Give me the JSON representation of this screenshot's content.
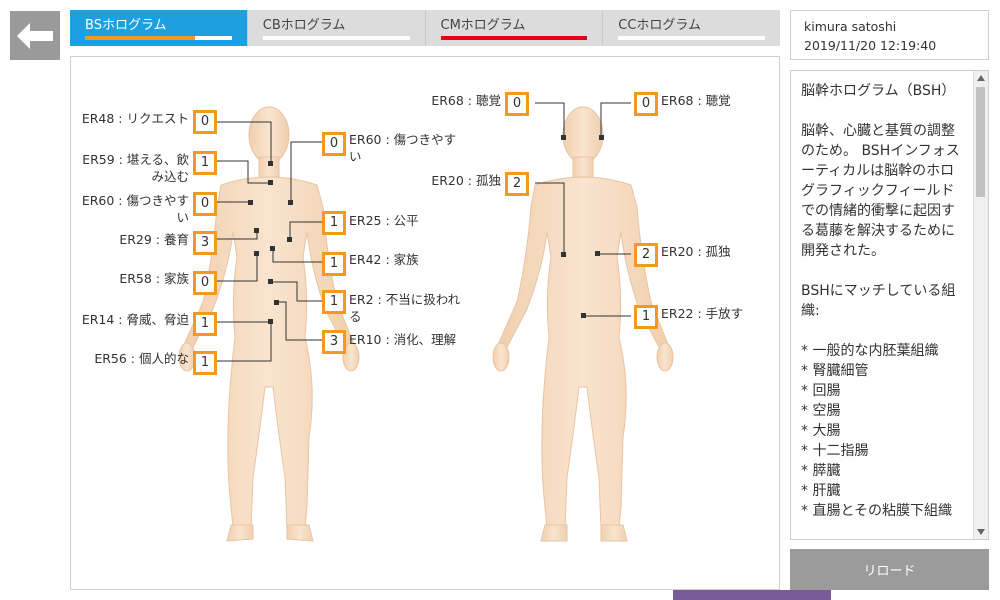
{
  "tabs": [
    {
      "label": "BSホログラム",
      "active": true,
      "bar_fill": 0.75,
      "bar_color": "#f39a1e"
    },
    {
      "label": "CBホログラム",
      "active": false,
      "bar_fill": 0,
      "bar_color": "#ffffff"
    },
    {
      "label": "CMホログラム",
      "active": false,
      "bar_fill": 1.0,
      "bar_color": "#e60012"
    },
    {
      "label": "CCホログラム",
      "active": false,
      "bar_fill": 0,
      "bar_color": "#ffffff"
    }
  ],
  "user": {
    "name": "kimura satoshi",
    "datetime": "2019/11/20 12:19:40"
  },
  "front_points": [
    {
      "label": "ER48 : リクエスト",
      "value": "0"
    },
    {
      "label": "ER59 : 堪える、飲み込む",
      "value": "1"
    },
    {
      "label": "ER60 : 傷つきやすい",
      "value": "0"
    },
    {
      "label": "ER29 : 養育",
      "value": "3"
    },
    {
      "label": "ER58 : 家族",
      "value": "0"
    },
    {
      "label": "ER14 : 脅威、脅迫",
      "value": "1"
    },
    {
      "label": "ER56 : 個人的な",
      "value": "1"
    },
    {
      "label": "ER60 : 傷つきやすい",
      "value": "0"
    },
    {
      "label": "ER25 : 公平",
      "value": "1"
    },
    {
      "label": "ER42 : 家族",
      "value": "1"
    },
    {
      "label": "ER2 : 不当に扱われる",
      "value": "1"
    },
    {
      "label": "ER10 : 消化、理解",
      "value": "3"
    }
  ],
  "back_points": [
    {
      "label": "ER68 : 聴覚",
      "value": "0"
    },
    {
      "label": "ER20 : 孤独",
      "value": "2"
    },
    {
      "label": "ER68 : 聴覚",
      "value": "0"
    },
    {
      "label": "ER20 : 孤独",
      "value": "2"
    },
    {
      "label": "ER22 : 手放す",
      "value": "1"
    }
  ],
  "description": {
    "title": "脳幹ホログラム（BSH）",
    "body": "脳幹、心臓と基質の調整のため。 BSHインフォスーティカルは脳幹のホログラフィックフィールドでの情緒的衝撃に起因する葛藤を解決するために開発された。",
    "list_title": "BSHにマッチしている組織:",
    "items": [
      "* 一般的な内胚葉組織",
      "* 腎臓細管",
      "* 回腸",
      "* 空腸",
      "* 大腸",
      "* 十二指腸",
      "* 膵臓",
      "* 肝臓",
      "* 直腸とその粘膜下組織"
    ]
  },
  "reload_label": "リロード",
  "colors": {
    "accent": "#1e9fe0",
    "box_border": "#f39a1e",
    "skin": "#f6dcc2"
  }
}
